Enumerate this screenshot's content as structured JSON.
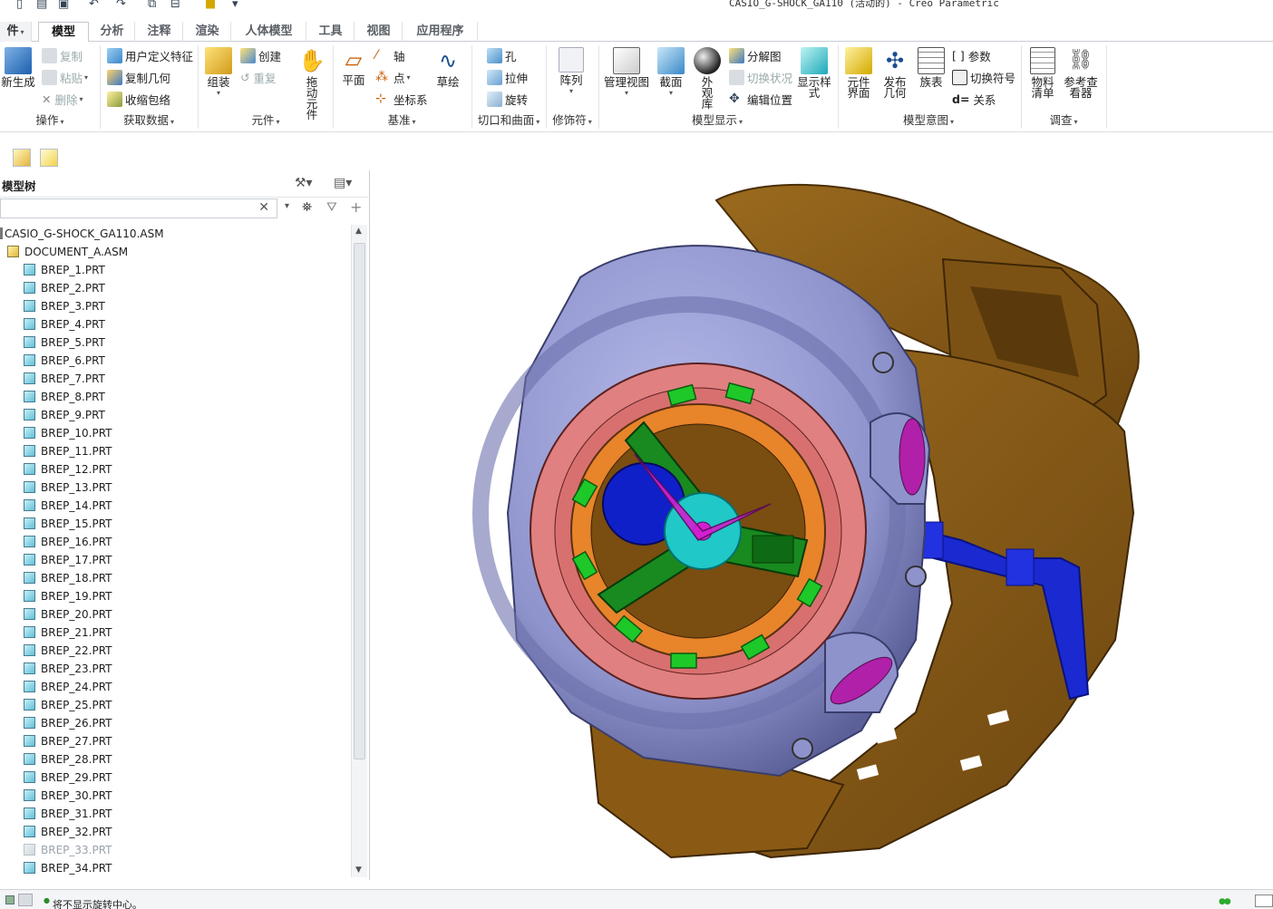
{
  "window": {
    "title": "CASIO_G-SHOCK_GA110 (活动的) - Creo Parametric"
  },
  "tabs": [
    {
      "label": "文件",
      "display": "件"
    },
    {
      "label": "模型"
    },
    {
      "label": "分析"
    },
    {
      "label": "注释"
    },
    {
      "label": "渲染"
    },
    {
      "label": "人体模型"
    },
    {
      "label": "工具"
    },
    {
      "label": "视图"
    },
    {
      "label": "应用程序"
    }
  ],
  "ribbon": {
    "operations": {
      "regenerate": "新生成",
      "copy": "复制",
      "paste": "粘贴",
      "delete": "删除",
      "group": "操作"
    },
    "get_data": {
      "udf": "用户定义特征",
      "copy_geom": "复制几何",
      "shrinkwrap": "收缩包络",
      "group": "获取数据"
    },
    "component": {
      "assemble": "组装",
      "create": "创建",
      "repeat": "重复",
      "drag": "拖动元件",
      "group": "元件"
    },
    "datum": {
      "plane": "平面",
      "axis": "轴",
      "point": "点",
      "csys": "坐标系",
      "sketch": "草绘",
      "group": "基准"
    },
    "cut_surface": {
      "hole": "孔",
      "extrude": "拉伸",
      "revolve": "旋转",
      "group": "切口和曲面"
    },
    "modifiers": {
      "pattern": "阵列",
      "group": "修饰符"
    },
    "model_display": {
      "manage_views": "管理视图",
      "section": "截面",
      "appearance": "外观库",
      "exploded": "分解图",
      "toggle_status": "切换状况",
      "edit_position": "编辑位置",
      "display_style": "显示样式",
      "group": "模型显示"
    },
    "model_intent": {
      "component_interface": "元件界面",
      "publish_geom": "发布几何",
      "family_table": "族表",
      "params": "参数",
      "switch_symbols": "切换符号",
      "relations": "关系",
      "group": "模型意图"
    },
    "investigate": {
      "bom": "物料清单",
      "ref_viewer": "参考查看器",
      "group": "调查"
    }
  },
  "model_tree": {
    "title": "模型树",
    "search_placeholder": "",
    "root": "CASIO_G-SHOCK_GA110.ASM",
    "sub": "DOCUMENT_A.ASM",
    "parts": [
      "BREP_1.PRT",
      "BREP_2.PRT",
      "BREP_3.PRT",
      "BREP_4.PRT",
      "BREP_5.PRT",
      "BREP_6.PRT",
      "BREP_7.PRT",
      "BREP_8.PRT",
      "BREP_9.PRT",
      "BREP_10.PRT",
      "BREP_11.PRT",
      "BREP_12.PRT",
      "BREP_13.PRT",
      "BREP_14.PRT",
      "BREP_15.PRT",
      "BREP_16.PRT",
      "BREP_17.PRT",
      "BREP_18.PRT",
      "BREP_19.PRT",
      "BREP_20.PRT",
      "BREP_21.PRT",
      "BREP_22.PRT",
      "BREP_23.PRT",
      "BREP_24.PRT",
      "BREP_25.PRT",
      "BREP_26.PRT",
      "BREP_27.PRT",
      "BREP_28.PRT",
      "BREP_29.PRT",
      "BREP_30.PRT",
      "BREP_31.PRT",
      "BREP_32.PRT",
      "BREP_33.PRT",
      "BREP_34.PRT"
    ],
    "dimmed_part": "BREP_33.PRT"
  },
  "status": {
    "message": "将不显示旋转中心。"
  },
  "colors": {
    "strap": "#8a5a14",
    "bezel": "#8e93cc",
    "ring": "#e08080",
    "dial_orange": "#e08a20",
    "green": "#1ec828",
    "cyan": "#20c8c8",
    "magenta": "#d020d0",
    "blue": "#1020c8"
  }
}
